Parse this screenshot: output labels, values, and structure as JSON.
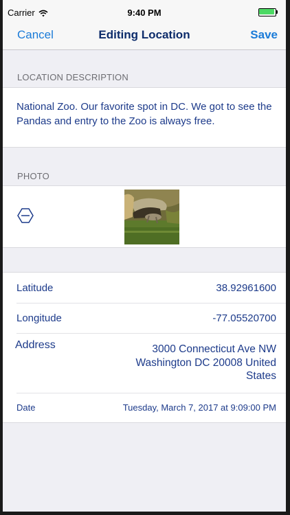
{
  "status_bar": {
    "carrier": "Carrier",
    "time": "9:40 PM"
  },
  "nav": {
    "cancel_label": "Cancel",
    "title": "Editing Location",
    "save_label": "Save"
  },
  "description_section": {
    "header": "LOCATION DESCRIPTION",
    "text": "National Zoo.  Our favorite spot in DC.  We got to see the Pandas and entry to the Zoo is always free."
  },
  "photo_section": {
    "header": "PHOTO",
    "remove_icon": "remove-circle-icon"
  },
  "details": {
    "latitude_label": "Latitude",
    "latitude_value": "38.92961600",
    "longitude_label": "Longitude",
    "longitude_value": "-77.05520700",
    "address_label": "Address",
    "address_line1": "3000 Connecticut Ave NW",
    "address_line2": "Washington DC 20008 United",
    "address_line3": "States",
    "date_label": "Date",
    "date_value": "Tuesday, March 7, 2017 at 9:09:00 PM"
  },
  "colors": {
    "accent": "#1a7bd8",
    "title": "#0d2c6b",
    "text": "#1c3a8a",
    "background": "#efeff4",
    "battery": "#4cd964"
  }
}
